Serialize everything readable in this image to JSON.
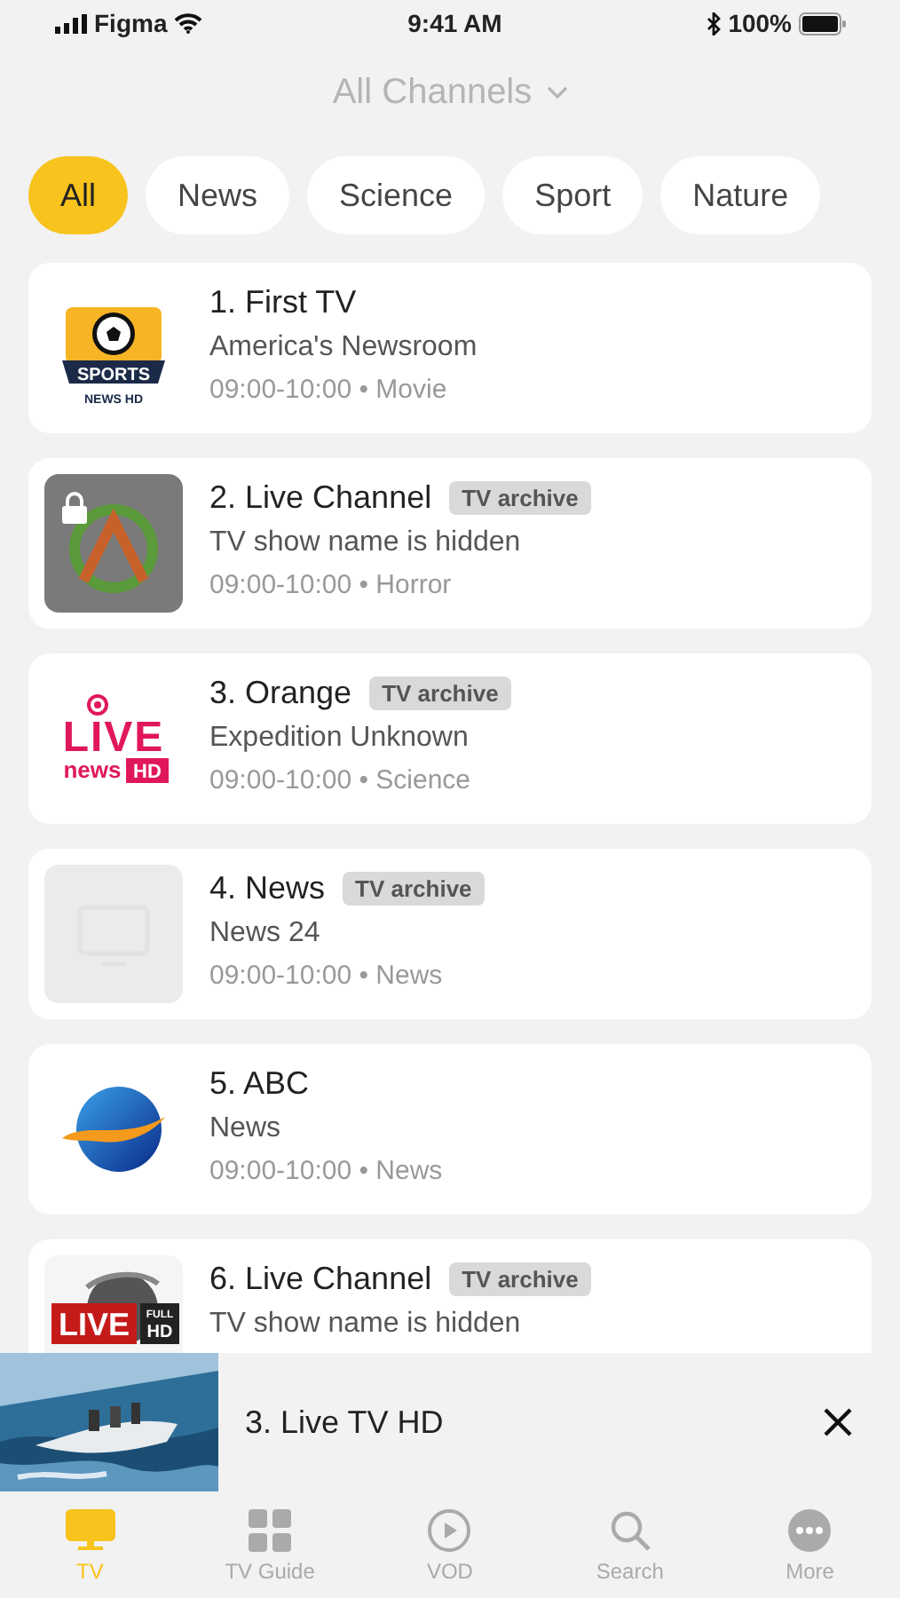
{
  "status_bar": {
    "carrier": "Figma",
    "time": "9:41 AM",
    "battery": "100%"
  },
  "header": {
    "title": "All Channels"
  },
  "filters": [
    {
      "label": "All",
      "selected": true
    },
    {
      "label": "News",
      "selected": false
    },
    {
      "label": "Science",
      "selected": false
    },
    {
      "label": "Sport",
      "selected": false
    },
    {
      "label": "Nature",
      "selected": false
    }
  ],
  "channels": [
    {
      "name": "1. First TV",
      "show": "America's Newsroom",
      "schedule": "09:00-10:00 • Movie",
      "logo": {
        "kind": "sports",
        "texts": [
          "SPORTS",
          "NEWS HD"
        ]
      }
    },
    {
      "name": "2. Live Channel",
      "badge": "TV archive",
      "show": "TV show name is hidden",
      "schedule": "09:00-10:00 • Horror",
      "logo": {
        "kind": "locked"
      }
    },
    {
      "name": "3. Orange",
      "badge": "TV archive",
      "show": "Expedition Unknown",
      "schedule": "09:00-10:00 • Science",
      "logo": {
        "kind": "live-news",
        "texts": [
          "LIVE",
          "news",
          "HD"
        ]
      }
    },
    {
      "name": "4. News",
      "badge": "TV archive",
      "show": "News 24",
      "schedule": "09:00-10:00 • News",
      "logo": {
        "kind": "placeholder"
      }
    },
    {
      "name": "5. ABC",
      "show": "News",
      "schedule": "09:00-10:00 • News",
      "logo": {
        "kind": "globe"
      }
    },
    {
      "name": "6. Live Channel",
      "badge": "TV archive",
      "show": "TV show name is hidden",
      "logo": {
        "kind": "live-hd",
        "texts": [
          "LIVE",
          "FULL",
          "HD"
        ]
      }
    }
  ],
  "mini_player": {
    "title": "3. Live TV HD"
  },
  "tab_bar": [
    {
      "label": "TV",
      "kind": "tv",
      "selected": true
    },
    {
      "label": "TV Guide",
      "kind": "guide",
      "selected": false
    },
    {
      "label": "VOD",
      "kind": "vod",
      "selected": false
    },
    {
      "label": "Search",
      "kind": "search",
      "selected": false
    },
    {
      "label": "More",
      "kind": "more",
      "selected": false
    }
  ]
}
